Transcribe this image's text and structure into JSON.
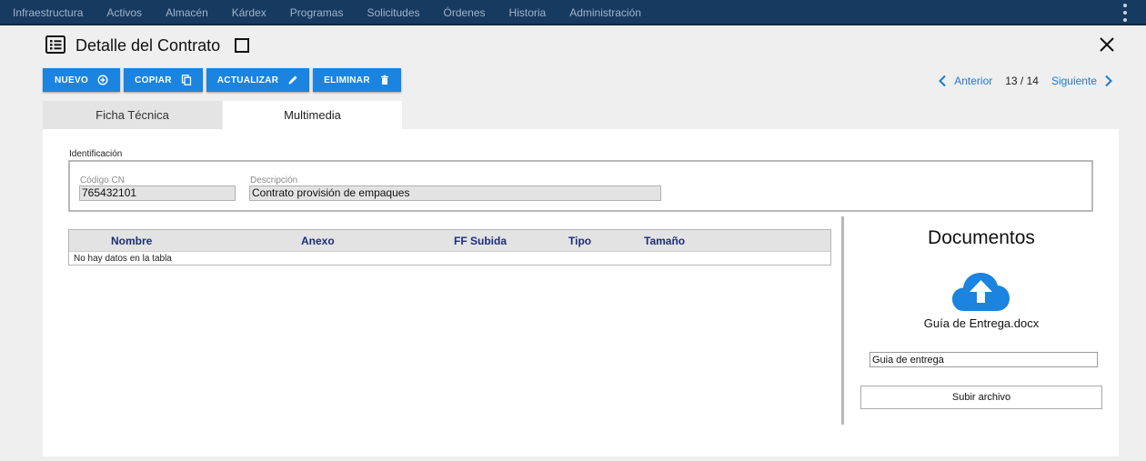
{
  "nav": {
    "items": [
      "Infraestructura",
      "Activos",
      "Almacén",
      "Kárdex",
      "Programas",
      "Solicitudes",
      "Órdenes",
      "Historia",
      "Administración"
    ]
  },
  "header": {
    "title": "Detalle del Contrato"
  },
  "toolbar": {
    "nuevo": "NUEVO",
    "copiar": "COPIAR",
    "actualizar": "ACTUALIZAR",
    "eliminar": "ELIMINAR"
  },
  "pager": {
    "prev": "Anterior",
    "count": "13 / 14",
    "next": "Siguiente"
  },
  "tabs": [
    {
      "label": "Ficha Técnica",
      "active": false
    },
    {
      "label": "Multimedia",
      "active": true
    }
  ],
  "identificacion": {
    "legend": "Identificación",
    "codigo_label": "Código CN",
    "codigo_value": "765432101",
    "descripcion_label": "Descripción",
    "descripcion_value": "Contrato provisión de empaques"
  },
  "table": {
    "columns": [
      "Nombre",
      "Anexo",
      "FF Subida",
      "Tipo",
      "Tamaño"
    ],
    "empty": "No hay datos en la tabla"
  },
  "documents": {
    "title": "Documentos",
    "file_name": "Guía de Entrega.docx",
    "input_value": "Guia de entrega",
    "upload_label": "Subir archivo"
  },
  "colors": {
    "nav_bg": "#173a61",
    "accent": "#1a84e0",
    "link": "#1a7bd1"
  }
}
